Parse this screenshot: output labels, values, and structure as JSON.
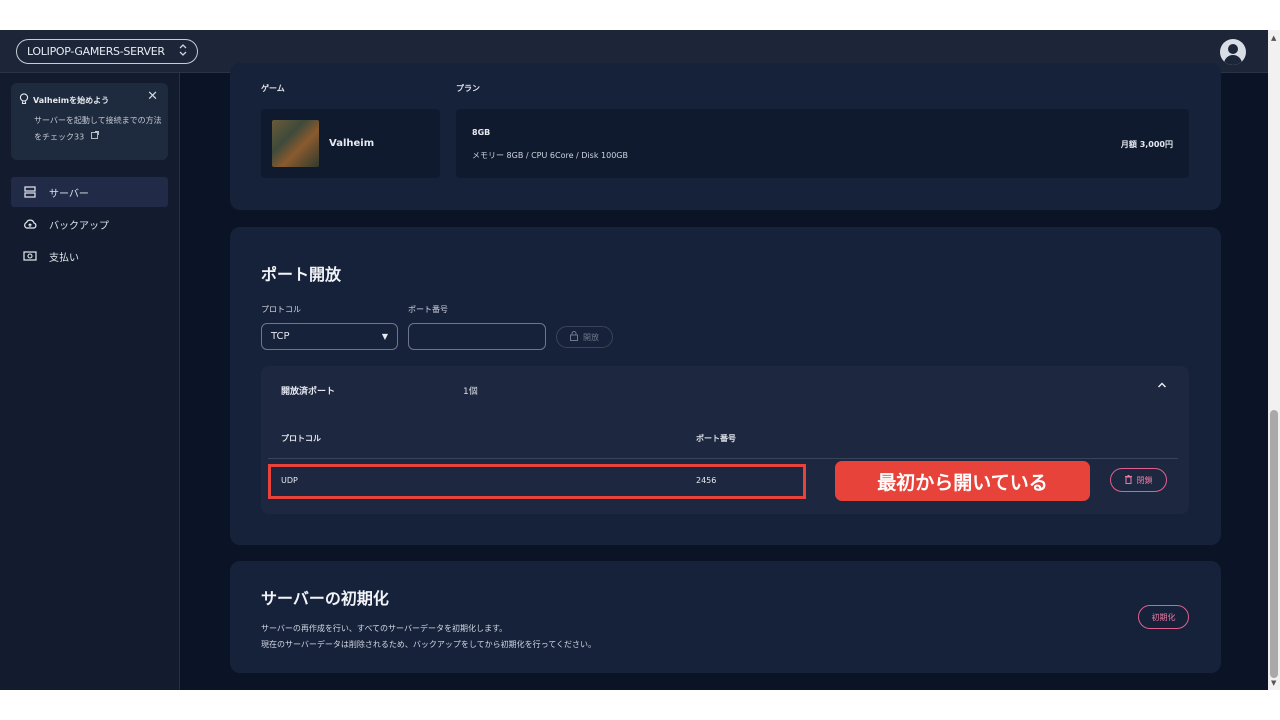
{
  "header": {
    "server_name": "LOLIPOP-GAMERS-SERVER",
    "server_chevron": "⌃⌄"
  },
  "sidebar": {
    "tip": {
      "title": "Valheimを始めよう",
      "body": "サーバーを起動して接続までの方法をチェック33"
    },
    "items": [
      {
        "label": "サーバー",
        "icon": "server-icon",
        "active": true
      },
      {
        "label": "バックアップ",
        "icon": "cloud-upload-icon",
        "active": false
      },
      {
        "label": "支払い",
        "icon": "payment-icon",
        "active": false
      }
    ]
  },
  "game_section": {
    "game_label": "ゲーム",
    "plan_label": "プラン",
    "game_name": "Valheim",
    "plan_name": "8GB",
    "plan_spec": "メモリー 8GB / CPU 6Core / Disk 100GB",
    "plan_price": "月額 3,000円"
  },
  "port_section": {
    "title": "ポート開放",
    "protocol_label": "プロトコル",
    "port_number_label": "ポート番号",
    "protocol_value": "TCP",
    "port_input_value": "",
    "open_button": "開放",
    "opened_ports": {
      "title": "開放済ポート",
      "count": "1個",
      "columns": [
        "プロトコル",
        "ポート番号"
      ],
      "rows": [
        {
          "protocol": "UDP",
          "port": "2456",
          "action": "閉鎖"
        }
      ]
    }
  },
  "reset_section": {
    "title": "サーバーの初期化",
    "line1": "サーバーの再作成を行い、すべてのサーバーデータを初期化します。",
    "line2": "現在のサーバーデータは削除されるため、バックアップをしてから初期化を行ってください。",
    "button": "初期化"
  },
  "annotation": {
    "callout": "最初から開いている",
    "color": "#e8433a"
  },
  "colors": {
    "background": "#0b1426",
    "card": "#16213a",
    "accent_pink": "#e0608e"
  }
}
